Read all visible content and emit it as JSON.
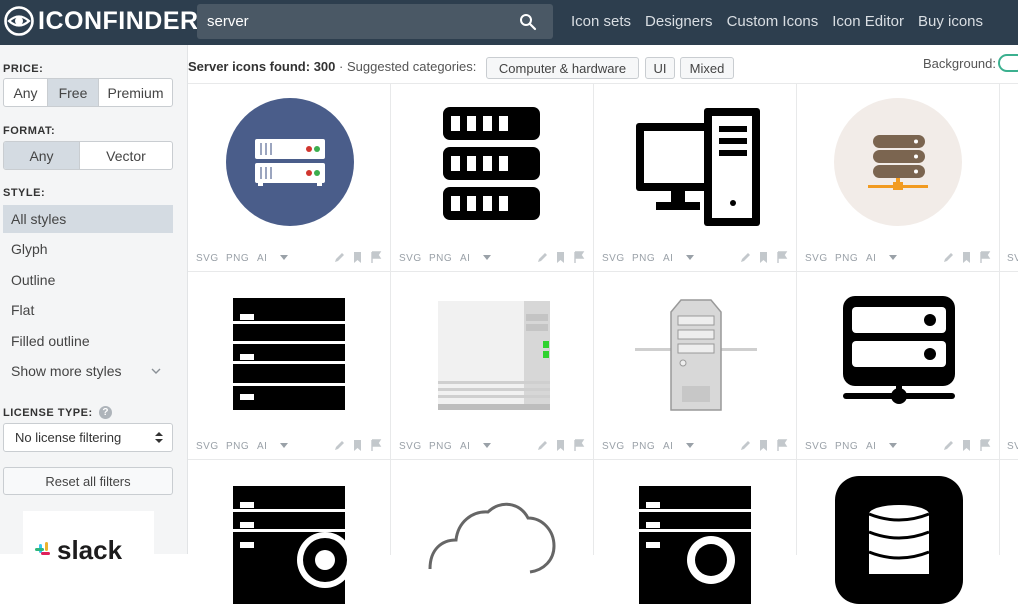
{
  "header": {
    "logo_text": "ICONFINDER",
    "search": {
      "value": "server",
      "icon": "search-icon"
    },
    "nav": [
      "Icon sets",
      "Designers",
      "Custom Icons",
      "Icon Editor",
      "Buy icons"
    ]
  },
  "sidebar": {
    "price": {
      "label": "PRICE:",
      "options": [
        "Any",
        "Free",
        "Premium"
      ],
      "selected": "Free"
    },
    "format": {
      "label": "FORMAT:",
      "options": [
        "Any",
        "Vector"
      ],
      "selected": "Any"
    },
    "style": {
      "label": "STYLE:",
      "items": [
        "All styles",
        "Glyph",
        "Outline",
        "Flat",
        "Filled outline",
        "Show more styles"
      ],
      "selected": "All styles"
    },
    "license": {
      "label": "LICENSE TYPE:",
      "help": "?",
      "value": "No license filtering"
    },
    "reset_label": "Reset all filters",
    "ad_text": "slack"
  },
  "results": {
    "found_prefix": "Server icons found:",
    "found_count": "300",
    "suggested_label": "· Suggested categories:",
    "categories": [
      "Computer & hardware",
      "UI",
      "Mixed"
    ],
    "background_label": "Background:"
  },
  "icon_actions": {
    "formats": [
      "SVG",
      "PNG",
      "AI"
    ]
  },
  "icons": [
    {
      "name": "server-circle-icon"
    },
    {
      "name": "server-rack-glyph-icon"
    },
    {
      "name": "desktop-computer-icon"
    },
    {
      "name": "database-network-icon"
    },
    {
      "name": "server-stack-glyph-icon"
    },
    {
      "name": "server-tower-3d-icon"
    },
    {
      "name": "server-tower-network-icon"
    },
    {
      "name": "server-network-icon"
    },
    {
      "name": "server-settings-icon"
    },
    {
      "name": "cloud-outline-icon"
    },
    {
      "name": "server-search-icon"
    },
    {
      "name": "database-icon"
    }
  ],
  "colors": {
    "topbar": "#2d3e4e",
    "search_bg": "#4a5865",
    "circle_blue": "#4a5d8a",
    "circle_beige": "#f2ece8",
    "db_brown": "#7b6550",
    "accent_orange": "#f29b21",
    "toggle_green": "#3bb08f"
  }
}
